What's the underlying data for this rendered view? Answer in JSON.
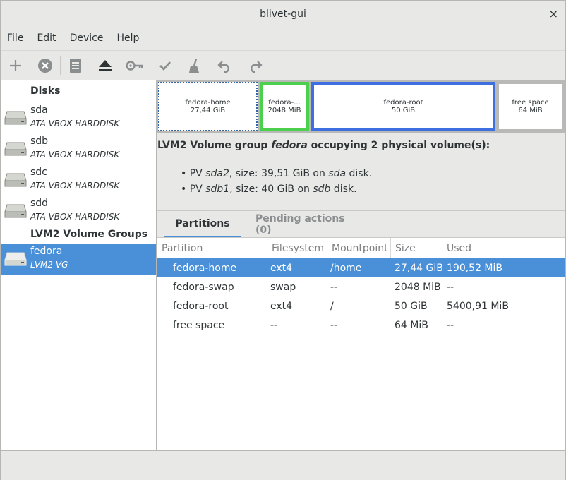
{
  "window": {
    "title": "blivet-gui",
    "close_glyph": "×"
  },
  "menu": [
    "File",
    "Edit",
    "Device",
    "Help"
  ],
  "toolbar": {
    "icons": [
      "add-icon",
      "delete-icon",
      "properties-icon",
      "eject-icon",
      "key-icon",
      "apply-icon",
      "clear-icon",
      "undo-icon",
      "redo-icon"
    ]
  },
  "sidebar": {
    "disks_header": "Disks",
    "disks": [
      {
        "name": "sda",
        "model": "ATA VBOX HARDDISK"
      },
      {
        "name": "sdb",
        "model": "ATA VBOX HARDDISK"
      },
      {
        "name": "sdc",
        "model": "ATA VBOX HARDDISK"
      },
      {
        "name": "sdd",
        "model": "ATA VBOX HARDDISK"
      }
    ],
    "vg_header": "LVM2 Volume Groups",
    "vgs": [
      {
        "name": "fedora",
        "type": "LVM2 VG",
        "selected": true
      }
    ]
  },
  "visualization": {
    "blocks": [
      {
        "name": "fedora-home",
        "size": "27,44 GiB",
        "border_color": "#3465a4"
      },
      {
        "name": "fedora-...",
        "size": "2048 MiB",
        "border_color": "#4ccf4c"
      },
      {
        "name": "fedora-root",
        "size": "50 GiB",
        "border_color": "#3d6fe0"
      },
      {
        "name": "free space",
        "size": "64 MiB",
        "border_color": "#b9b9b7"
      }
    ]
  },
  "info": {
    "title_pre": "LVM2 Volume group ",
    "title_vg": "fedora",
    "title_post": " occupying 2 physical volume(s):",
    "pvs": [
      {
        "bullet": "•",
        "pre": "PV ",
        "dev": "sda2",
        "mid": ", size: 39,51 GiB on ",
        "disk": "sda",
        "post": " disk."
      },
      {
        "bullet": "•",
        "pre": "PV ",
        "dev": "sdb1",
        "mid": ", size: 40 GiB on ",
        "disk": "sdb",
        "post": " disk."
      }
    ]
  },
  "tabs": [
    {
      "label": "Partitions",
      "active": true
    },
    {
      "label": "Pending actions (0)",
      "active": false
    }
  ],
  "table": {
    "columns": [
      "Partition",
      "Filesystem",
      "Mountpoint",
      "Size",
      "Used"
    ],
    "rows": [
      {
        "cells": [
          "fedora-home",
          "ext4",
          "/home",
          "27,44 GiB",
          "190,52 MiB"
        ],
        "selected": true
      },
      {
        "cells": [
          "fedora-swap",
          "swap",
          "--",
          "2048 MiB",
          "--"
        ],
        "selected": false
      },
      {
        "cells": [
          "fedora-root",
          "ext4",
          "/",
          "50 GiB",
          "5400,91 MiB"
        ],
        "selected": false
      },
      {
        "cells": [
          "free space",
          "--",
          "--",
          "64 MiB",
          "--"
        ],
        "selected": false
      }
    ]
  },
  "colors": {
    "accent": "#4a90d9",
    "swap_green": "#4ccf4c",
    "root_blue": "#3d6fe0"
  }
}
